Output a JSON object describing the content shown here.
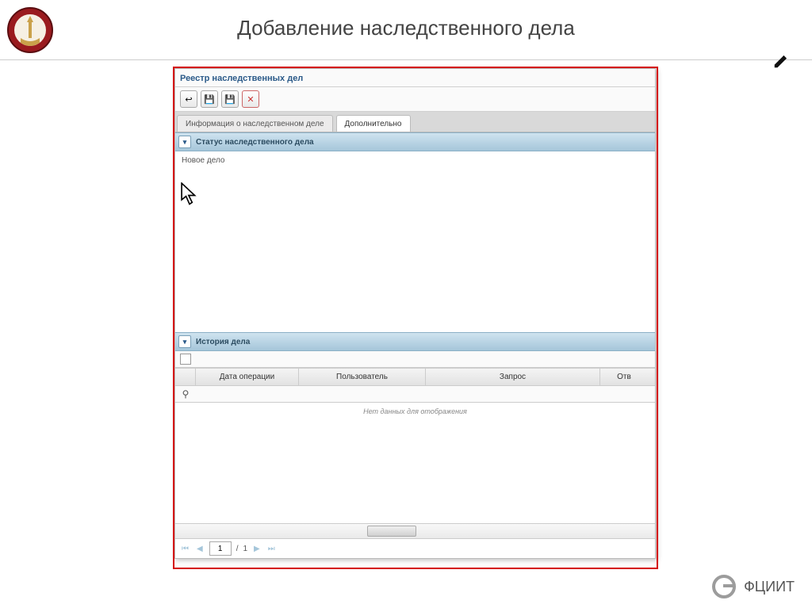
{
  "slide": {
    "title": "Добавление наследственного дела"
  },
  "app": {
    "title": "Реестр наследственных дел",
    "toolbar": {
      "back_icon": "↩",
      "save_icon": "💾",
      "save2_icon": "💾",
      "close_icon": "✕"
    },
    "tabs": [
      {
        "label": "Информация о наследственном деле",
        "active": false
      },
      {
        "label": "Дополнительно",
        "active": true
      }
    ],
    "status_panel": {
      "header": "Статус наследственного дела",
      "body": "Новое дело"
    },
    "history_panel": {
      "header": "История дела",
      "columns": {
        "c0": "",
        "c1": "Дата операции",
        "c2": "Пользователь",
        "c3": "Запрос",
        "c4": "Отв"
      },
      "nodata": "Нет данных для отображения"
    },
    "pager": {
      "page": "1",
      "sep": "/",
      "total": "1"
    }
  },
  "footer": {
    "brand": "ФЦИИТ"
  }
}
